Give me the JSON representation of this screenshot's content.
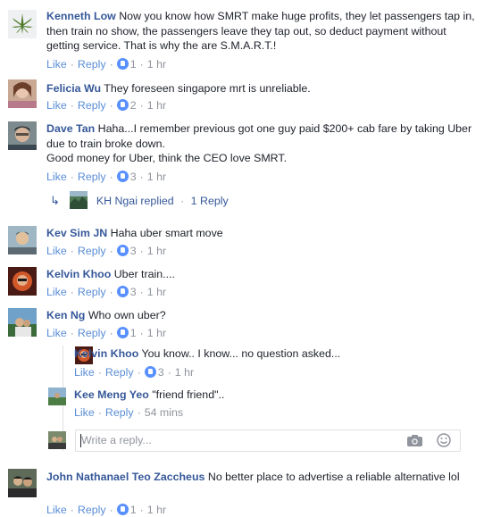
{
  "actions": {
    "like": "Like",
    "reply": "Reply",
    "sep": "·"
  },
  "comments": [
    {
      "name": "Kenneth Low",
      "text": "Now you know how SMRT make huge profits, they let passengers tap in, then train no show, the passengers leave they tap out, so deduct payment without getting service. That is why the are S.M.A.R.T.!",
      "count": "1",
      "time": "1 hr"
    },
    {
      "name": "Felicia Wu",
      "text": "They foreseen singapore mrt is unreliable.",
      "count": "2",
      "time": "1 hr"
    },
    {
      "name": "Dave Tan",
      "text": "Haha...I remember previous got one guy paid $200+ cab fare by taking Uber due to train broke down.",
      "text2": "Good money for Uber, think the CEO love SMRT.",
      "count": "3",
      "time": "1 hr"
    },
    {
      "name": "Kev Sim JN",
      "text": "Haha uber smart move",
      "count": "3",
      "time": "1 hr"
    },
    {
      "name": "Kelvin Khoo",
      "text": "Uber train....",
      "count": "3",
      "time": "1 hr"
    },
    {
      "name": "Ken Ng",
      "text": "Who own uber?",
      "count": "1",
      "time": "1 hr"
    },
    {
      "name": "Kelvin Khoo",
      "text": "You know.. I know... no question asked...",
      "count": "3",
      "time": "1 hr"
    },
    {
      "name": "Kee Meng Yeo",
      "text": "\"friend friend\"..",
      "time": "54 mins"
    },
    {
      "name": "John Nathanael Teo Zaccheus",
      "text": "No better place to advertise a reliable alternative lol",
      "count": "1",
      "time": "1 hr"
    }
  ],
  "replies_summary": {
    "name": "KH Ngai",
    "text": "replied",
    "sep": "·",
    "count_text": "1 Reply"
  },
  "reply_box": {
    "placeholder": "Write a reply...",
    "camera_icon": "camera-icon",
    "emoji_icon": "emoji-icon"
  },
  "colors": {
    "link": "#365899",
    "meta": "#90949c",
    "react": "#5890ff"
  }
}
